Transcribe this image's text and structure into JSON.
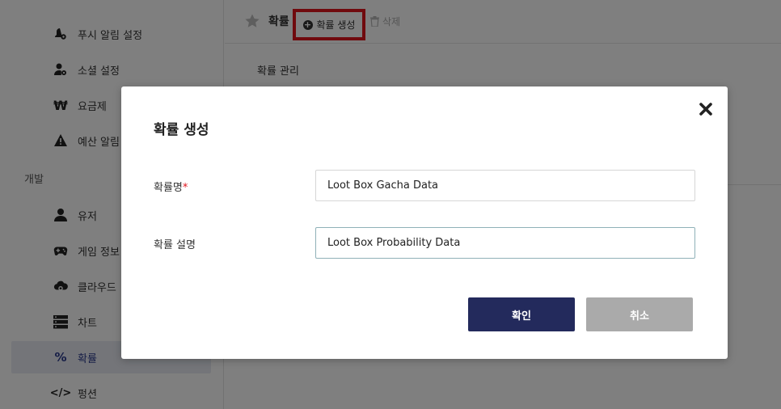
{
  "sidebar": {
    "items": [
      {
        "label": "푸시 알림 설정",
        "icon": "bell-gear-icon"
      },
      {
        "label": "소셜 설정",
        "icon": "user-gear-icon"
      },
      {
        "label": "요금제",
        "icon": "won-icon"
      },
      {
        "label": "예산 알림",
        "icon": "warning-icon"
      }
    ],
    "section_label": "개발",
    "dev_items": [
      {
        "label": "유저",
        "icon": "user-icon"
      },
      {
        "label": "게임 정보",
        "icon": "gamepad-icon"
      },
      {
        "label": "클라우드",
        "icon": "cloud-icon"
      },
      {
        "label": "차트",
        "icon": "server-icon"
      },
      {
        "label": "확률",
        "icon": "percent-icon",
        "active": true
      },
      {
        "label": "펑션",
        "icon": "code-icon"
      }
    ]
  },
  "toolbar": {
    "title": "확률",
    "create_label": "확률 생성",
    "delete_label": "삭제"
  },
  "main": {
    "section_title": "확률 관리"
  },
  "modal": {
    "title": "확률 생성",
    "name_label": "확률명",
    "required_mark": "*",
    "name_value": "Loot Box Gacha Data",
    "desc_label": "확률 설명",
    "desc_value": "Loot Box Probability Data",
    "confirm_label": "확인",
    "cancel_label": "취소"
  },
  "colors": {
    "highlight_border": "#e0141d",
    "confirm_button": "#232a5c",
    "cancel_button": "#aaaaaa",
    "active_sidebar": "#2b3a8c"
  }
}
